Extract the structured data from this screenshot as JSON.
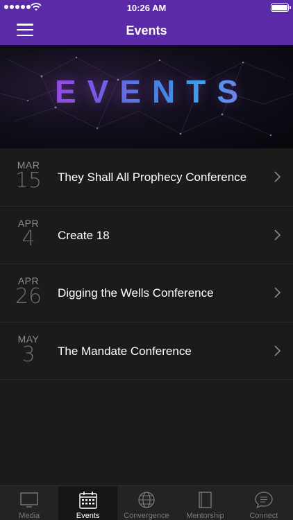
{
  "status_bar": {
    "time": "10:26 AM"
  },
  "nav": {
    "title": "Events"
  },
  "banner": {
    "title": "EVENTS"
  },
  "events": [
    {
      "month": "MAR",
      "day": "15",
      "title": "They Shall All Prophecy Conference"
    },
    {
      "month": "APR",
      "day": "4",
      "title": "Create 18"
    },
    {
      "month": "APR",
      "day": "26",
      "title": "Digging the Wells Conference"
    },
    {
      "month": "MAY",
      "day": "3",
      "title": "The Mandate Conference"
    }
  ],
  "tabs": [
    {
      "label": "Media",
      "icon": "tv-icon"
    },
    {
      "label": "Events",
      "icon": "calendar-icon",
      "active": true
    },
    {
      "label": "Convergence",
      "icon": "globe-icon"
    },
    {
      "label": "Mentorship",
      "icon": "book-icon"
    },
    {
      "label": "Connect",
      "icon": "chat-icon"
    }
  ],
  "colors": {
    "nav_purple": "#5a2aa8",
    "background": "#1b1b1b",
    "tabbar": "#232323"
  }
}
